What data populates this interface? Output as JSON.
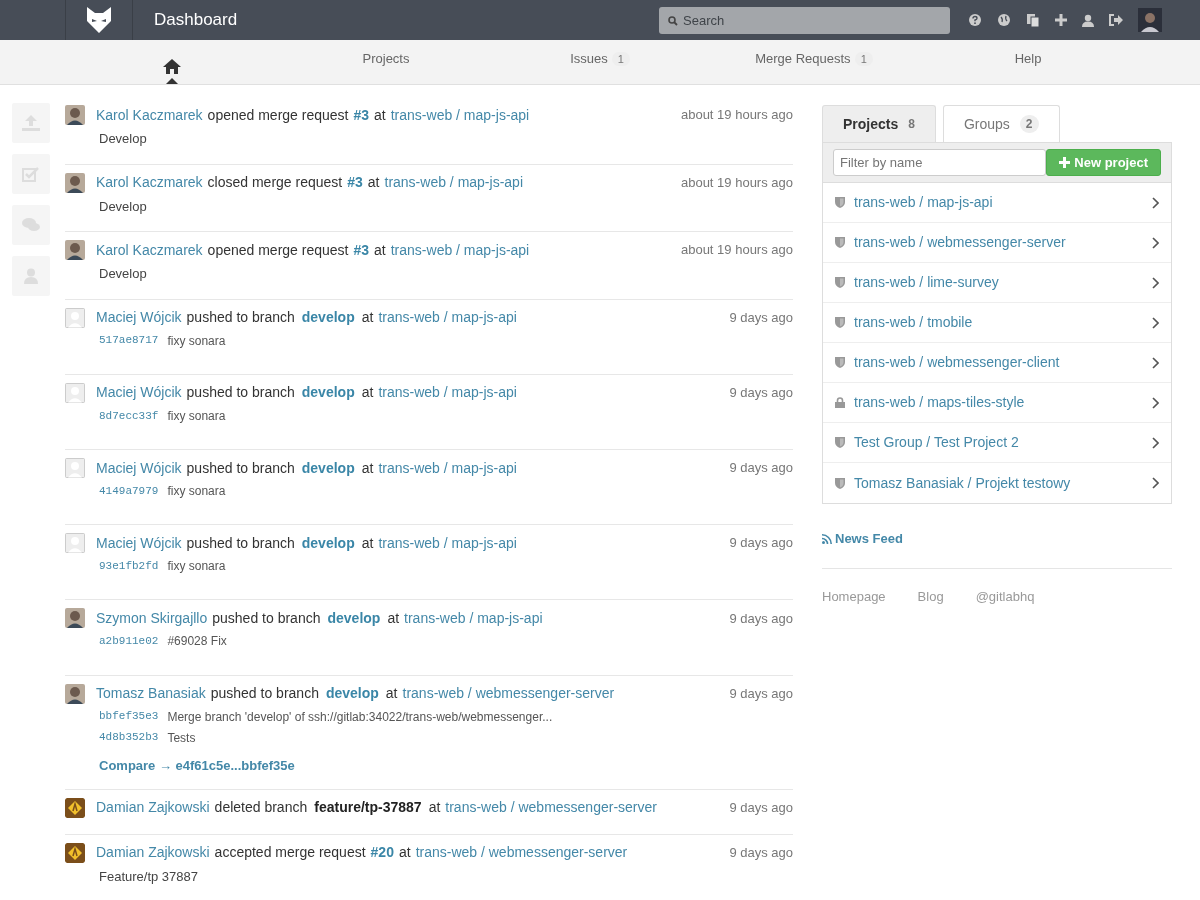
{
  "header": {
    "title": "Dashboard",
    "search": {
      "placeholder": "Search"
    }
  },
  "nav": [
    {
      "kind": "home",
      "selected": true
    },
    {
      "kind": "text",
      "label": "Projects",
      "selected": false
    },
    {
      "kind": "text",
      "label": "Issues",
      "count": "1",
      "selected": false
    },
    {
      "kind": "text",
      "label": "Merge Requests",
      "count": "1",
      "selected": false
    },
    {
      "kind": "text",
      "label": "Help",
      "selected": false
    }
  ],
  "events": [
    {
      "author": "Karol Kaczmarek",
      "avatar": {
        "kind": "photo"
      },
      "action": "opened merge request",
      "ref": {
        "text": "#3",
        "kind": "mr"
      },
      "joiner": "at",
      "project": "trans-web / map-js-api",
      "time": "about 19 hours ago",
      "note": "Develop"
    },
    {
      "author": "Karol Kaczmarek",
      "avatar": {
        "kind": "photo"
      },
      "action": "closed merge request",
      "ref": {
        "text": "#3",
        "kind": "mr"
      },
      "joiner": "at",
      "project": "trans-web / map-js-api",
      "time": "about 19 hours ago",
      "note": "Develop"
    },
    {
      "author": "Karol Kaczmarek",
      "avatar": {
        "kind": "photo"
      },
      "action": "opened merge request",
      "ref": {
        "text": "#3",
        "kind": "mr"
      },
      "joiner": "at",
      "project": "trans-web / map-js-api",
      "time": "about 19 hours ago",
      "note": "Develop"
    },
    {
      "author": "Maciej Wójcik",
      "avatar": {
        "kind": "blank"
      },
      "action": "pushed to branch",
      "ref": {
        "text": "develop",
        "kind": "branch"
      },
      "joiner": "at",
      "project": "trans-web / map-js-api",
      "time": "9 days ago",
      "commits": [
        {
          "sha": "517ae8717",
          "message": "fixy sonara"
        }
      ]
    },
    {
      "author": "Maciej Wójcik",
      "avatar": {
        "kind": "blank"
      },
      "action": "pushed to branch",
      "ref": {
        "text": "develop",
        "kind": "branch"
      },
      "joiner": "at",
      "project": "trans-web / map-js-api",
      "time": "9 days ago",
      "commits": [
        {
          "sha": "8d7ecc33f",
          "message": "fixy sonara"
        }
      ]
    },
    {
      "author": "Maciej Wójcik",
      "avatar": {
        "kind": "blank"
      },
      "action": "pushed to branch",
      "ref": {
        "text": "develop",
        "kind": "branch"
      },
      "joiner": "at",
      "project": "trans-web / map-js-api",
      "time": "9 days ago",
      "commits": [
        {
          "sha": "4149a7979",
          "message": "fixy sonara"
        }
      ]
    },
    {
      "author": "Maciej Wójcik",
      "avatar": {
        "kind": "blank"
      },
      "action": "pushed to branch",
      "ref": {
        "text": "develop",
        "kind": "branch"
      },
      "joiner": "at",
      "project": "trans-web / map-js-api",
      "time": "9 days ago",
      "commits": [
        {
          "sha": "93e1fb2fd",
          "message": "fixy sonara"
        }
      ]
    },
    {
      "author": "Szymon Skirgajllo",
      "avatar": {
        "kind": "photo"
      },
      "action": "pushed to branch",
      "ref": {
        "text": "develop",
        "kind": "branch"
      },
      "joiner": "at",
      "project": "trans-web / map-js-api",
      "time": "9 days ago",
      "commits": [
        {
          "sha": "a2b911e02",
          "message": "#69028 Fix"
        }
      ]
    },
    {
      "author": "Tomasz Banasiak",
      "avatar": {
        "kind": "photo"
      },
      "action": "pushed to branch",
      "ref": {
        "text": "develop",
        "kind": "branch"
      },
      "joiner": "at",
      "project": "trans-web / webmessenger-server",
      "time": "9 days ago",
      "commits": [
        {
          "sha": "bbfef35e3",
          "message": "Merge branch 'develop' of ssh://gitlab:34022/trans-web/webmessenger..."
        },
        {
          "sha": "4d8b352b3",
          "message": "Tests"
        }
      ],
      "compare": "Compare → e4f61c5e...bbfef35e"
    },
    {
      "author": "Damian Zajkowski",
      "avatar": {
        "kind": "logo"
      },
      "action": "deleted branch",
      "ref": {
        "text": "feature/tp-37887",
        "kind": "deleted"
      },
      "joiner": "at",
      "project": "trans-web / webmessenger-server",
      "time": "9 days ago"
    },
    {
      "author": "Damian Zajkowski",
      "avatar": {
        "kind": "logo"
      },
      "action": "accepted merge request",
      "ref": {
        "text": "#20",
        "kind": "mr"
      },
      "joiner": "at",
      "project": "trans-web / webmessenger-server",
      "time": "9 days ago",
      "note": "Feature/tp 37887"
    }
  ],
  "side_tabs": [
    {
      "label": "Projects",
      "count": "8",
      "selected": true
    },
    {
      "label": "Groups",
      "count": "2",
      "selected": false
    }
  ],
  "filter": {
    "placeholder": "Filter by name"
  },
  "new_project": "New project",
  "projects": [
    {
      "name": "trans-web / map-js-api",
      "kind": "internal"
    },
    {
      "name": "trans-web / webmessenger-server",
      "kind": "internal"
    },
    {
      "name": "trans-web / lime-survey",
      "kind": "internal"
    },
    {
      "name": "trans-web / tmobile",
      "kind": "internal"
    },
    {
      "name": "trans-web / webmessenger-client",
      "kind": "internal"
    },
    {
      "name": "trans-web / maps-tiles-style",
      "kind": "private"
    },
    {
      "name": "Test Group / Test Project 2",
      "kind": "internal"
    },
    {
      "name": "Tomasz Banasiak / Projekt testowy",
      "kind": "internal"
    }
  ],
  "news_feed": "News Feed",
  "footer_links": [
    "Homepage",
    "Blog",
    "@gitlabhq"
  ]
}
